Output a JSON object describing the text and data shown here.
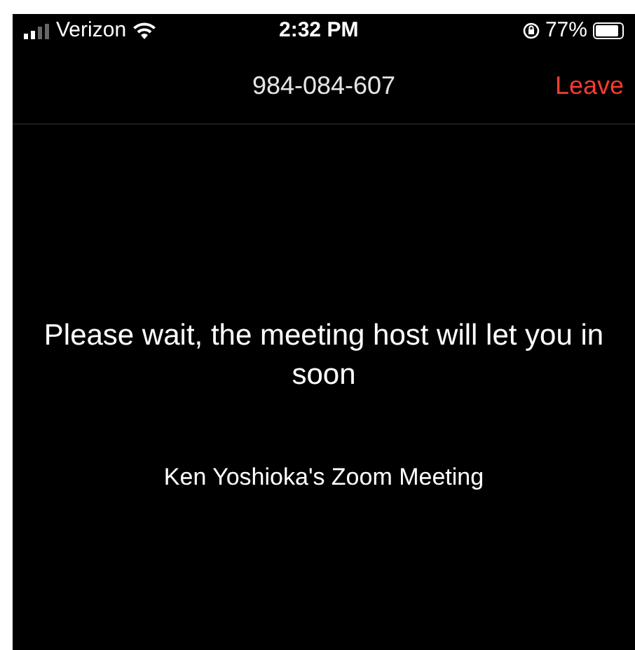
{
  "status_bar": {
    "carrier": "Verizon",
    "time": "2:32 PM",
    "battery": "77%"
  },
  "header": {
    "meeting_id": "984-084-607",
    "leave_button": "Leave"
  },
  "message": "Please wait, the meeting host will let you in soon",
  "meeting_name": "Ken Yoshioka's Zoom Meeting"
}
